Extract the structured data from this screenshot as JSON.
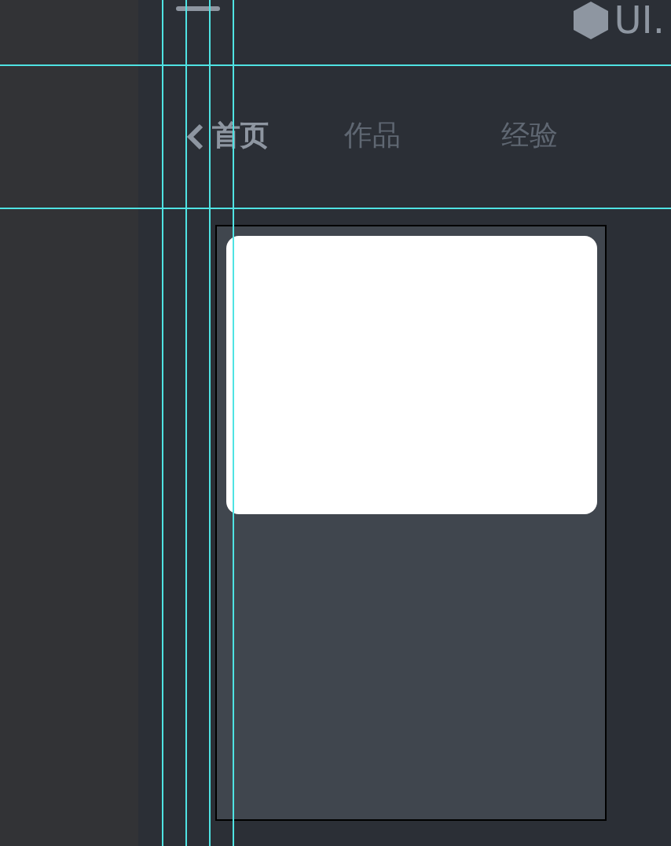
{
  "header": {
    "logo_text": "UI."
  },
  "tabs": [
    {
      "label": "首页",
      "selected": true
    },
    {
      "label": "作品",
      "selected": false
    },
    {
      "label": "经验",
      "selected": false
    }
  ]
}
